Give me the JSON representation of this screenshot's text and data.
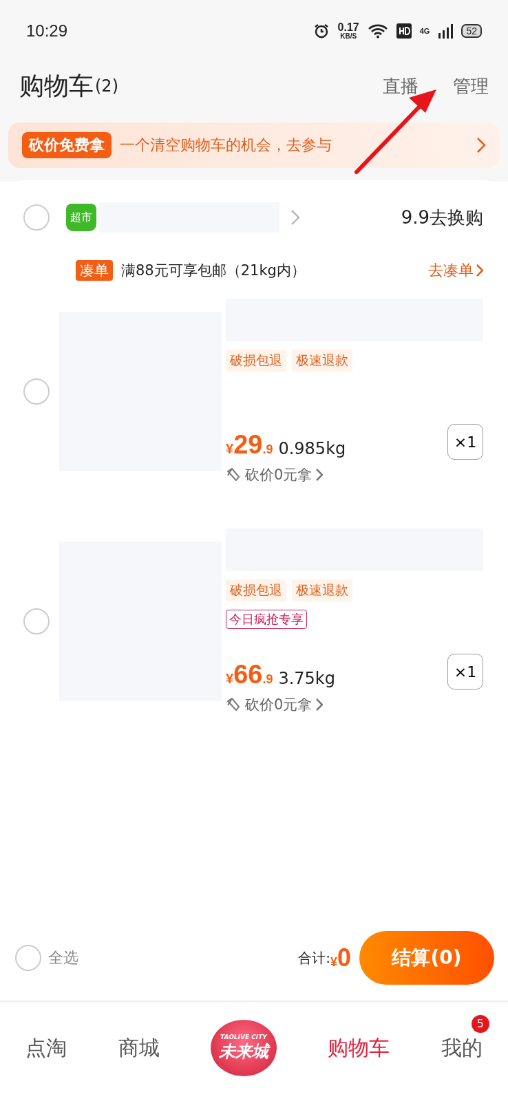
{
  "status_bar": {
    "time": "10:29",
    "net_speed": "0.17",
    "net_unit": "KB/S",
    "network": "4G",
    "battery": "52"
  },
  "header": {
    "title": "购物车",
    "count": "(2)",
    "actions": [
      "直播",
      "管理"
    ]
  },
  "banner": {
    "badge": "砍价免费拿",
    "text": "一个清空购物车的机会，去参与"
  },
  "store": {
    "checked": false,
    "badge": "超市",
    "action": "9.9去换购",
    "bundle": {
      "tag": "凑单",
      "text": "满88元可享包邮（21kg内）",
      "link": "去凑单"
    }
  },
  "items": [
    {
      "checked": false,
      "tags": [
        "破损包退",
        "极速退款"
      ],
      "price_symbol": "¥",
      "price_int": "29",
      "price_dec": ".9",
      "weight": "0.985kg",
      "quantity": "×1",
      "bargain": "砍价0元拿"
    },
    {
      "checked": false,
      "tags": [
        "破损包退",
        "极速退款"
      ],
      "promo": "今日疯抢专享",
      "price_symbol": "¥",
      "price_int": "66",
      "price_dec": ".9",
      "weight": "3.75kg",
      "quantity": "×1",
      "bargain": "砍价0元拿"
    }
  ],
  "footer": {
    "select_all": {
      "label": "全选",
      "checked": false
    },
    "total_label": "合计:",
    "total_symbol": "¥",
    "total": "0",
    "checkout": "结算(0)"
  },
  "nav": [
    {
      "kind": "text",
      "label": "点淘",
      "selected": false
    },
    {
      "kind": "text",
      "label": "商城",
      "selected": false
    },
    {
      "kind": "logo",
      "top": "TAOLIVE CITY",
      "label": "未来城",
      "selected": false
    },
    {
      "kind": "text",
      "label": "购物车",
      "selected": true
    },
    {
      "kind": "text",
      "label": "我的",
      "selected": false,
      "badge": "5"
    }
  ]
}
